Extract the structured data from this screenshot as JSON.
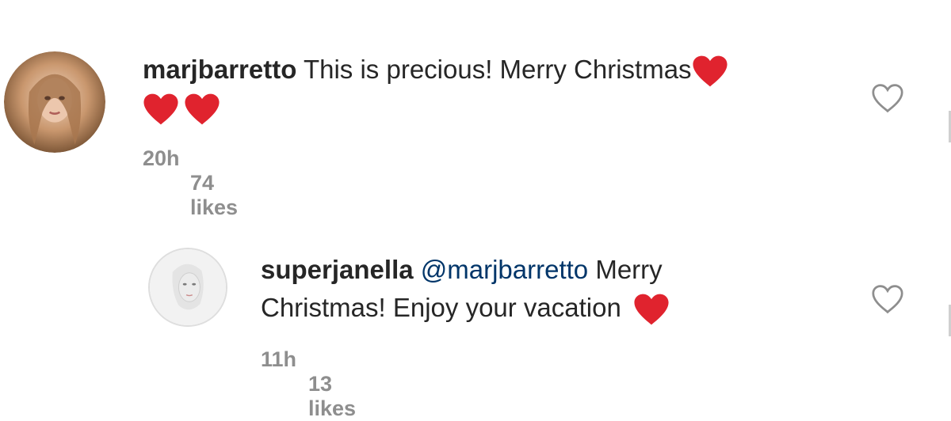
{
  "comments": [
    {
      "username": "marjbarretto",
      "text": "This is precious! Merry Christmas",
      "emoji": "red-heart",
      "time": "20h",
      "likes": "74 likes"
    },
    {
      "username": "superjanella",
      "mention": "@marjbarretto",
      "text_line1": "Merry",
      "text_line2": "Christmas! Enjoy your vacation",
      "emoji": "red-heart",
      "time": "11h",
      "likes": "13 likes"
    }
  ],
  "colors": {
    "text": "#262626",
    "meta": "#8e8e8e",
    "mention": "#003569",
    "heart_emoji": "#e0232e",
    "like_outline": "#8e8e8e"
  }
}
